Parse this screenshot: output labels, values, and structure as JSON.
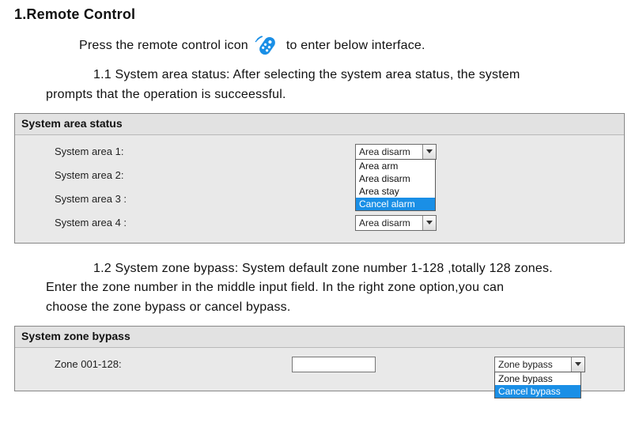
{
  "heading": "1.Remote Control",
  "intro_before_icon": "Press the remote control icon",
  "intro_after_icon": "to enter below interface.",
  "section_1_1_line1": "1.1 System area status: After selecting the system area status, the system",
  "section_1_1_line2": "prompts that the operation is succeessful.",
  "panel_area": {
    "title": "System area status",
    "rows": [
      {
        "label": "System area 1:",
        "value": "Area disarm"
      },
      {
        "label": "System area 2:",
        "value": ""
      },
      {
        "label": "System area 3 :",
        "value": ""
      },
      {
        "label": "System area 4 :",
        "value": "Area disarm"
      }
    ],
    "dropdown_options": [
      "Area arm",
      "Area disarm",
      "Area stay",
      "Cancel alarm"
    ],
    "dropdown_highlight_index": 3
  },
  "section_1_2_line1": "1.2 System zone bypass: System default zone number 1-128 ,totally 128 zones.",
  "section_1_2_line2": "Enter the zone number in the middle input field. In the right zone option,you can",
  "section_1_2_line3": "choose the zone bypass or cancel bypass.",
  "panel_zone": {
    "title": "System zone bypass",
    "row_label": "Zone 001-128:",
    "input_value": "",
    "select_value": "Zone bypass",
    "dropdown_options": [
      "Zone bypass",
      "Cancel bypass"
    ],
    "dropdown_highlight_index": 1
  }
}
